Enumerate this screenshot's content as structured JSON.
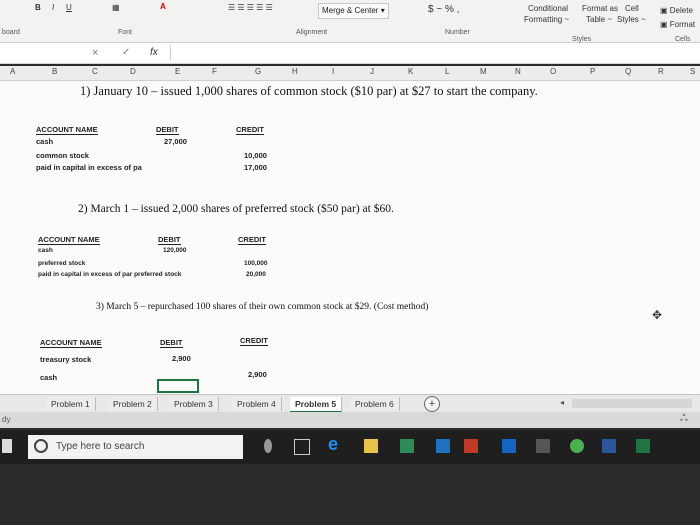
{
  "ribbon": {
    "merge_center": "Merge & Center",
    "currency": "$ ~ % ,",
    "conditional_line1": "Conditional",
    "conditional_line2": "Formatting ~",
    "format_as_line1": "Format as",
    "format_as_line2": "Table ~",
    "cell_line1": "Cell",
    "cell_line2": "Styles ~",
    "delete": "Delete",
    "format": "Format",
    "groups": {
      "clipboard": "board",
      "font": "Font",
      "alignment": "Alignment",
      "number": "Number",
      "styles": "Styles",
      "cells": "Cells"
    }
  },
  "formula_bar": {
    "fx": "fx",
    "cancel": "×",
    "confirm": "✓"
  },
  "columns": [
    "A",
    "B",
    "C",
    "D",
    "E",
    "F",
    "G",
    "H",
    "I",
    "J",
    "K",
    "L",
    "M",
    "N",
    "O",
    "P",
    "Q",
    "R",
    "S"
  ],
  "problem1": {
    "title": "1) January 10 – issued 1,000 shares of common stock ($10 par) at $27 to start the company.",
    "headers": {
      "account": "ACCOUNT NAME",
      "debit": "DEBIT",
      "credit": "CREDIT"
    },
    "rows": [
      {
        "account": "cash",
        "debit": "27,000",
        "credit": ""
      },
      {
        "account": "common stock",
        "debit": "",
        "credit": "10,000"
      },
      {
        "account": "paid in capital in excess of pa",
        "debit": "",
        "credit": "17,000"
      }
    ]
  },
  "problem2": {
    "title": "2) March 1 – issued 2,000 shares of preferred stock ($50 par) at $60.",
    "headers": {
      "account": "ACCOUNT NAME",
      "debit": "DEBIT",
      "credit": "CREDIT"
    },
    "rows": [
      {
        "account": "cash",
        "debit": "120,000",
        "credit": ""
      },
      {
        "account": "preferred stock",
        "debit": "",
        "credit": "100,000"
      },
      {
        "account": "paid in capital in excess of par preferred stock",
        "debit": "",
        "credit": "20,000"
      }
    ]
  },
  "problem3": {
    "title": "3) March 5 – repurchased 100 shares of their own common stock at $29. (Cost method)",
    "headers": {
      "account": "ACCOUNT NAME",
      "debit": "DEBIT",
      "credit": "CREDIT"
    },
    "rows": [
      {
        "account": "treasury stock",
        "debit": "2,900",
        "credit": ""
      },
      {
        "account": "cash",
        "debit": "",
        "credit": "2,900"
      }
    ]
  },
  "tabs": [
    "Problem 1",
    "Problem 2",
    "Problem 3",
    "Problem 4",
    "Problem 5",
    "Problem 6"
  ],
  "active_tab": "Problem 5",
  "add_sheet": "+",
  "status": "dy",
  "taskbar": {
    "search_placeholder": "Type here to search"
  }
}
